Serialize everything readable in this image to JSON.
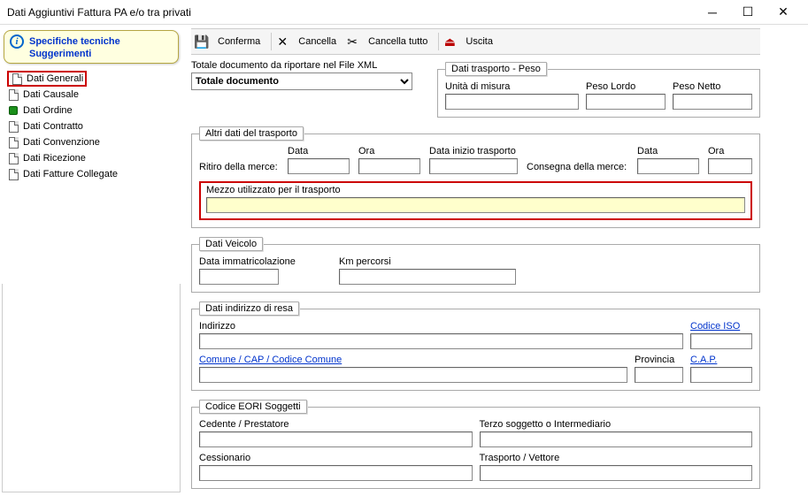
{
  "window": {
    "title": "Dati Aggiuntivi Fattura PA e/o tra privati"
  },
  "note": {
    "line1": "Specifiche tecniche",
    "line2": "Suggerimenti"
  },
  "tree": {
    "items": [
      {
        "label": "Dati Generali",
        "highlight": true,
        "icon": "doc"
      },
      {
        "label": "Dati Causale",
        "icon": "doc"
      },
      {
        "label": "Dati Ordine",
        "icon": "green"
      },
      {
        "label": "Dati Contratto",
        "icon": "doc"
      },
      {
        "label": "Dati Convenzione",
        "icon": "doc"
      },
      {
        "label": "Dati Ricezione",
        "icon": "doc"
      },
      {
        "label": "Dati Fatture Collegate",
        "icon": "doc"
      }
    ]
  },
  "toolbar": {
    "conferma": "Conferma",
    "cancella": "Cancella",
    "cancella_tutto": "Cancella tutto",
    "uscita": "Uscita"
  },
  "top": {
    "xml_label": "Totale documento da riportare nel File XML",
    "xml_select": "Totale documento",
    "peso_legend": "Dati trasporto - Peso",
    "unita": "Unità di misura",
    "peso_lordo": "Peso Lordo",
    "peso_netto": "Peso Netto"
  },
  "altri": {
    "legend": "Altri dati del trasporto",
    "ritiro": "Ritiro della merce:",
    "data": "Data",
    "ora": "Ora",
    "inizio": "Data inizio trasporto",
    "consegna": "Consegna della merce:",
    "mezzo": "Mezzo utilizzato per il trasporto"
  },
  "veicolo": {
    "legend": "Dati Veicolo",
    "imm": "Data immatricolazione",
    "km": "Km percorsi"
  },
  "resa": {
    "legend": "Dati indirizzo di resa",
    "indirizzo": "Indirizzo",
    "iso": "Codice ISO",
    "comune": "Comune / CAP / Codice Comune",
    "provincia": "Provincia",
    "cap": "C.A.P."
  },
  "eori": {
    "legend": "Codice EORI Soggetti",
    "cedente": "Cedente / Prestatore",
    "terzo": "Terzo soggetto o Intermediario",
    "cessionario": "Cessionario",
    "vettore": "Trasporto / Vettore"
  }
}
